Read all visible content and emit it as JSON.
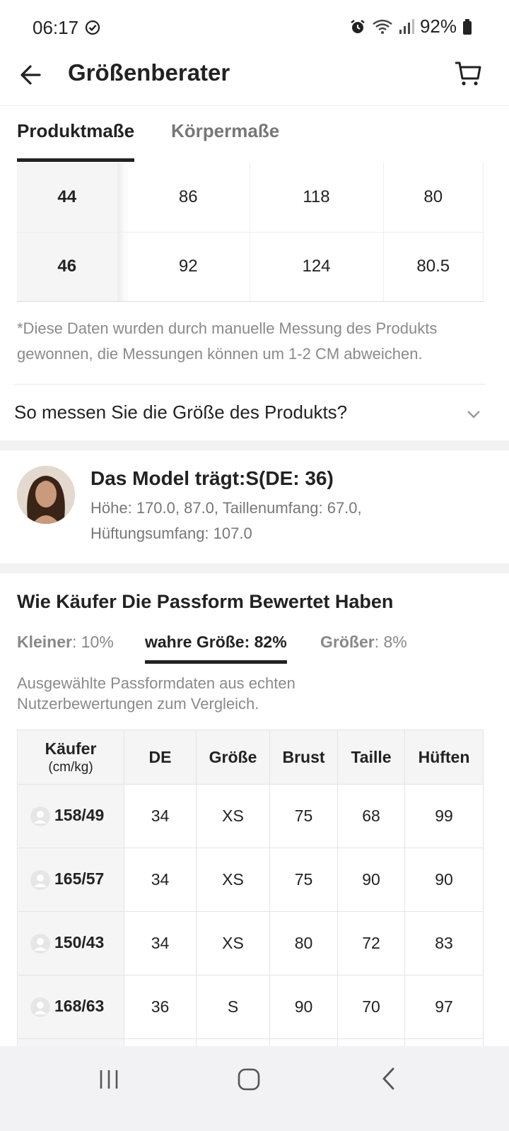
{
  "status_bar": {
    "time": "06:17",
    "battery": "92%"
  },
  "header": {
    "title": "Größenberater"
  },
  "tabs": [
    {
      "label": "Produktmaße",
      "active": true
    },
    {
      "label": "Körpermaße",
      "active": false
    }
  ],
  "size_table": {
    "rows": [
      {
        "size": "44",
        "c1": "86",
        "c2": "118",
        "c3": "80"
      },
      {
        "size": "46",
        "c1": "92",
        "c2": "124",
        "c3": "80.5"
      }
    ]
  },
  "note": "*Diese Daten wurden durch manuelle Messung des Produkts gewonnen, die Messungen können um 1-2 CM abweichen.",
  "howto": {
    "label": "So messen Sie die Größe des Produkts?"
  },
  "model": {
    "title": "Das Model trägt:S(DE: 36)",
    "line1": "Höhe: 170.0,   87.0,  Taillenumfang: 67.0,",
    "line2": "Hüftungsumfang: 107.0"
  },
  "fit": {
    "title": "Wie Käufer Die Passform Bewertet Haben",
    "smaller_label": "Kleiner",
    "smaller_value": ": 10%",
    "true_label": "wahre Größe: 82%",
    "larger_label": "Größer",
    "larger_value": ": 8%",
    "description": "Ausgewählte Passformdaten aus echten Nutzerbewertungen zum Vergleich."
  },
  "buyer_table": {
    "headers": {
      "buyer": "Käufer",
      "buyer_unit": "(cm/kg)",
      "de": "DE",
      "size": "Größe",
      "bust": "Brust",
      "waist": "Taille",
      "hips": "Hüften"
    },
    "rows": [
      {
        "buyer": "158/49",
        "de": "34",
        "size": "XS",
        "bust": "75",
        "waist": "68",
        "hips": "99"
      },
      {
        "buyer": "165/57",
        "de": "34",
        "size": "XS",
        "bust": "75",
        "waist": "90",
        "hips": "90"
      },
      {
        "buyer": "150/43",
        "de": "34",
        "size": "XS",
        "bust": "80",
        "waist": "72",
        "hips": "83"
      },
      {
        "buyer": "168/63",
        "de": "36",
        "size": "S",
        "bust": "90",
        "waist": "70",
        "hips": "97"
      }
    ]
  },
  "colors": {
    "text": "#222222",
    "muted": "#8a8a8a",
    "panel": "#f5f5f5",
    "divider": "#f2f2f2"
  },
  "icons": [
    "check-circle-icon",
    "alarm-icon",
    "wifi-icon",
    "signal-icon",
    "battery-icon",
    "back-arrow-icon",
    "cart-icon",
    "chevron-down-icon",
    "user-icon",
    "recents-icon",
    "home-icon",
    "back-icon"
  ]
}
